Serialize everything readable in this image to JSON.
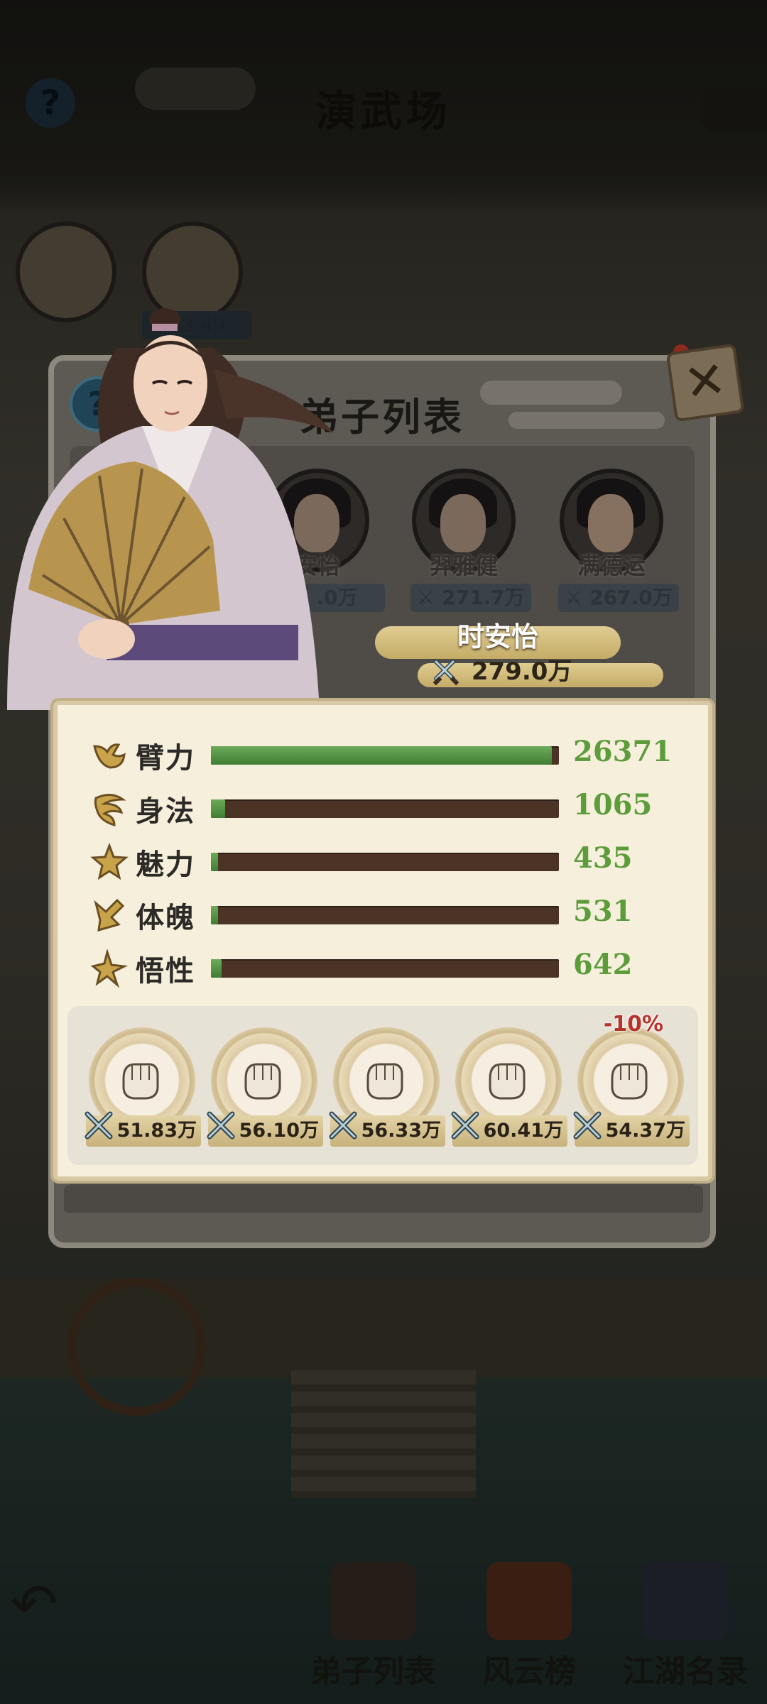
{
  "screen": {
    "title": "演武场",
    "help_icon": "question-icon",
    "timer": "03:49"
  },
  "modal": {
    "title": "弟子列表",
    "help_icon": "question-icon",
    "close_icon": "close-icon",
    "disciples": [
      {
        "name": "安怡",
        "power": ".0万"
      },
      {
        "name": "羿雅健",
        "power": "271.7万"
      },
      {
        "name": "满德运",
        "power": "267.0万"
      }
    ],
    "selected": {
      "name": "时安怡",
      "power": "279.0万"
    }
  },
  "stats": [
    {
      "label": "臂力",
      "value": "26371",
      "level": 0.98,
      "icon": "arm-strength-icon"
    },
    {
      "label": "身法",
      "value": "1065",
      "level": 0.04,
      "icon": "agility-icon"
    },
    {
      "label": "魅力",
      "value": "435",
      "level": 0.02,
      "icon": "charm-icon"
    },
    {
      "label": "体魄",
      "value": "531",
      "level": 0.02,
      "icon": "physique-icon"
    },
    {
      "label": "悟性",
      "value": "642",
      "level": 0.03,
      "icon": "insight-icon"
    }
  ],
  "martial_skills": [
    {
      "power": "51.83万",
      "modifier": ""
    },
    {
      "power": "56.10万",
      "modifier": ""
    },
    {
      "power": "56.33万",
      "modifier": ""
    },
    {
      "power": "60.41万",
      "modifier": ""
    },
    {
      "power": "54.37万",
      "modifier": "-10%"
    }
  ],
  "bottom_nav": [
    {
      "label": "弟子列表",
      "icon": "disciple-icon"
    },
    {
      "label": "风云榜",
      "icon": "ranking-scroll-icon"
    },
    {
      "label": "江湖名录",
      "icon": "book-icon"
    }
  ],
  "colors": {
    "stat_fill": "#4f8f3f",
    "stat_value": "#5c9c3a",
    "modifier": "#b8332a",
    "panel_bg": "#f6efdc"
  }
}
